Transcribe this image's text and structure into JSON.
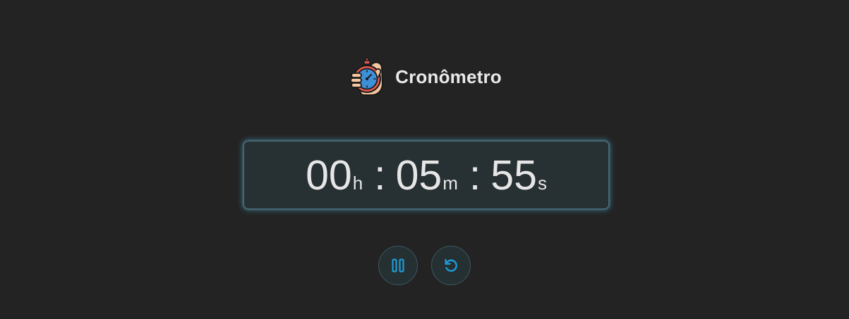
{
  "header": {
    "title": "Cronômetro",
    "logo_icon": "stopwatch-in-hand-icon"
  },
  "timer": {
    "hours": "00",
    "hours_unit": "h",
    "minutes": "05",
    "minutes_unit": "m",
    "seconds": "55",
    "seconds_unit": "s",
    "separator": ":"
  },
  "controls": {
    "pause_icon": "pause-icon",
    "reset_icon": "reset-icon"
  },
  "colors": {
    "background": "#232323",
    "panel": "#273032",
    "glow": "#4da8c9",
    "accent": "#1e9bd7",
    "text": "#e6e6e6"
  }
}
